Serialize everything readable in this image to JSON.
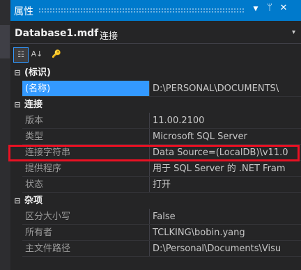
{
  "title": "属性",
  "buttons": {
    "dropdown": "▼",
    "pin": "ᛘ",
    "close": "✕"
  },
  "selector": {
    "object_name": "Database1.mdf",
    "object_type": "连接",
    "dropdown": "▾"
  },
  "toolbar": {
    "categorized": "☷",
    "alphabetical": "A↓",
    "property_pages": "🔑"
  },
  "categories": [
    {
      "label": "(标识)",
      "toggle": "⊟",
      "rows": [
        {
          "name": "(名称)",
          "value": "D:\\PERSONAL\\DOCUMENTS\\"
        }
      ]
    },
    {
      "label": "连接",
      "toggle": "⊟",
      "rows": [
        {
          "name": "版本",
          "value": "11.00.2100"
        },
        {
          "name": "类型",
          "value": "Microsoft SQL Server"
        },
        {
          "name": "连接字符串",
          "value": "Data Source=(LocalDB)\\v11.0"
        },
        {
          "name": "提供程序",
          "value": "用于 SQL Server 的 .NET Fram"
        },
        {
          "name": "状态",
          "value": "打开"
        }
      ]
    },
    {
      "label": "杂项",
      "toggle": "⊟",
      "rows": [
        {
          "name": "区分大小写",
          "value": "False"
        },
        {
          "name": "所有者",
          "value": "TCLKING\\bobin.yang"
        },
        {
          "name": "主文件路径",
          "value": "D:\\Personal\\Documents\\Visu"
        }
      ]
    }
  ],
  "colors": {
    "accent": "#007acc",
    "selected": "#3399ff",
    "highlight_box": "#e81123",
    "background": "#252526"
  }
}
